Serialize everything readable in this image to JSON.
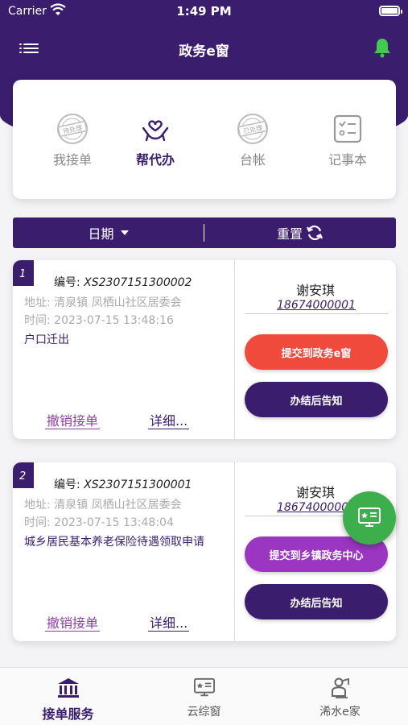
{
  "status_bar": {
    "carrier": "Carrier",
    "time": "1:49 PM"
  },
  "header": {
    "title": "政务e窗",
    "menu_icon": "list-menu-icon",
    "bell_icon": "bell-icon"
  },
  "quick_menu": [
    {
      "label": "我接单",
      "icon": "pending-stamp-icon",
      "stamp": "待处理",
      "active": false
    },
    {
      "label": "帮代办",
      "icon": "hands-heart-icon",
      "active": true
    },
    {
      "label": "台帐",
      "icon": "processed-stamp-icon",
      "stamp": "已处理",
      "active": false
    },
    {
      "label": "记事本",
      "icon": "checklist-icon",
      "active": false
    }
  ],
  "filter": {
    "date_label": "日期",
    "reset_label": "重置"
  },
  "orders": [
    {
      "index": "1",
      "order_label": "编号:",
      "order_no": "XS2307151300002",
      "address": "地址: 清泉镇 凤栖山社区居委会",
      "time": "时间: 2023-07-15 13:48:16",
      "item": "户口迁出",
      "cancel_label": "撤销接单",
      "detail_label": "详细...",
      "person": "谢安琪",
      "phone": "18674000001",
      "primary_button": "提交到政务e窗",
      "secondary_button": "办结后告知"
    },
    {
      "index": "2",
      "order_label": "编号:",
      "order_no": "XS2307151300001",
      "address": "地址: 清泉镇 凤栖山社区居委会",
      "time": "时间: 2023-07-15 13:48:04",
      "item": "城乡居民基本养老保险待遇领取申请",
      "cancel_label": "撤销接单",
      "detail_label": "详细...",
      "person": "谢安琪",
      "phone": "18674000001",
      "primary_button": "提交到乡镇政务中心",
      "secondary_button": "办结后告知"
    }
  ],
  "tabs": [
    {
      "label": "接单服务",
      "icon": "bank-building-icon",
      "active": true
    },
    {
      "label": "云综窗",
      "icon": "monitor-star-icon",
      "active": false
    },
    {
      "label": "浠水e家",
      "icon": "person-card-icon",
      "active": false
    }
  ],
  "colors": {
    "primary": "#3b1d6e",
    "accent_red": "#f04a3d",
    "accent_purple": "#9b36c2",
    "fab_green": "#3dae4c",
    "bell_green": "#43c94e"
  }
}
